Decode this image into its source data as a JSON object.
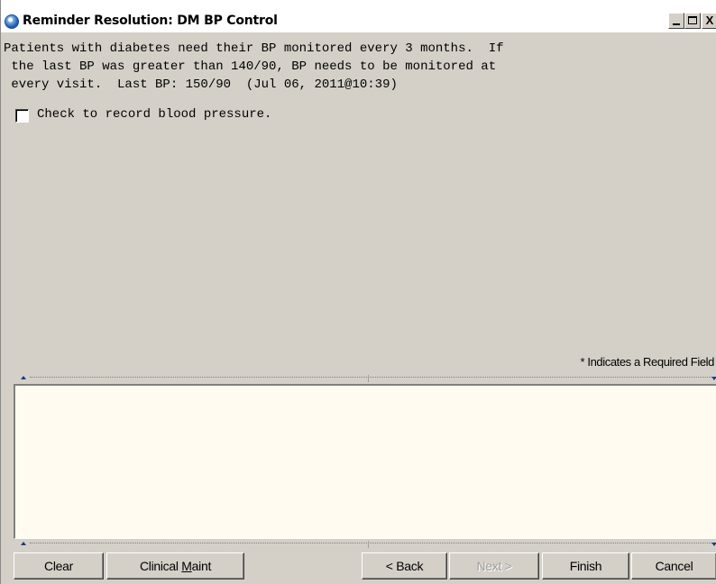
{
  "window": {
    "title": "Reminder Resolution: DM BP Control",
    "minimize_label": "_",
    "close_label": "X"
  },
  "content": {
    "lines": [
      "Patients with diabetes need their BP monitored every 3 months.  If",
      " the last BP was greater than 140/90, BP needs to be monitored at",
      " every visit.  Last BP: 150/90  (Jul 06, 2011@10:39)"
    ],
    "checkbox_label": "Check to record blood pressure.",
    "checkbox_checked": false
  },
  "required_note": "* Indicates a Required Field",
  "notes_text": "",
  "buttons": {
    "clear": "Clear",
    "clinical_maint_prefix": "Clinical ",
    "clinical_maint_underlined": "M",
    "clinical_maint_suffix": "aint",
    "back": "< Back",
    "next": "Next >",
    "finish": "Finish",
    "cancel": "Cancel"
  },
  "colors": {
    "window_bg": "#d4d0c8",
    "notes_bg": "#fffbf0",
    "title_icon": "#1c5fb0"
  },
  "icons": {
    "title_icon": "vista-globe-icon"
  }
}
